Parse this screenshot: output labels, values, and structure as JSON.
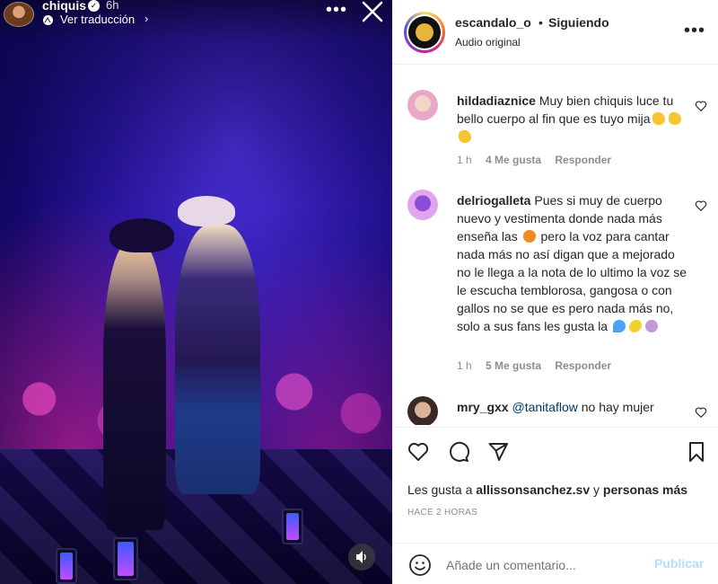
{
  "story": {
    "username": "chiquis",
    "time": "6h",
    "translate_label": "Ver traducción"
  },
  "post": {
    "username": "escandalo_o",
    "dot": "•",
    "follow_status": "Siguiendo",
    "audio": "Audio original",
    "liked_by_prefix": "Les gusta a ",
    "liked_by_user": "allissonsanchez.sv",
    "liked_by_and": " y ",
    "liked_by_others": "personas más",
    "posted_time": "HACE 2 HORAS"
  },
  "comments": [
    {
      "username": "hildadiaznice",
      "text": "Muy bien chiquis luce tu bello cuerpo al fin que es tuyo mija",
      "emojis": [
        "clapping-hands",
        "clapping-hands",
        "clapping-hands"
      ],
      "time": "1 h",
      "likes": "4 Me gusta",
      "reply": "Responder"
    },
    {
      "username": "delriogalleta",
      "text_part1": "Pues si muy de cuerpo nuevo y vestimenta donde nada más enseña las",
      "emoji_mid": "peach",
      "text_part2": "pero la voz para cantar nada más no así digan que a mejorado no le llega a la nota de lo ultimo la voz se le escucha temblorosa, gangosa o con gallos no se que es pero nada más no, solo a sus fans les gusta la",
      "emojis_end": [
        "sweat-droplets",
        "lemon",
        "person-shrugging"
      ],
      "time": "1 h",
      "likes": "5 Me gusta",
      "reply": "Responder"
    },
    {
      "username": "mry_gxx",
      "mention": "@tanitaflow",
      "text": "no hay mujer"
    }
  ],
  "composer": {
    "placeholder": "Añade un comentario...",
    "publish_label": "Publicar"
  },
  "colors": {
    "link": "#00376b",
    "publish_disabled": "#b2dffc",
    "secondary_text": "#8e8e8e",
    "primary_text": "#262626"
  }
}
